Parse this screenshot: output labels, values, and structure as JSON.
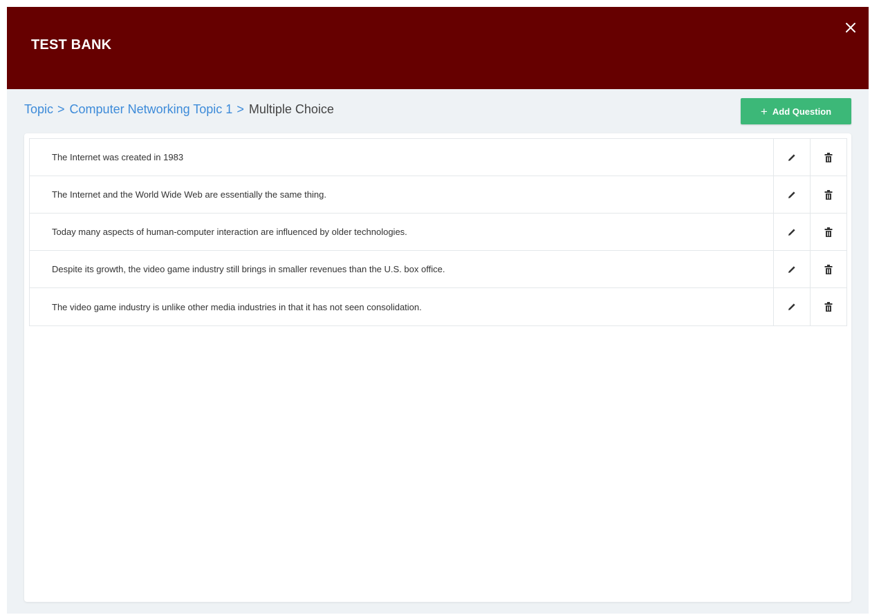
{
  "modal": {
    "title": "TEST BANK"
  },
  "breadcrumb": {
    "items": [
      "Topic",
      "Computer Networking Topic 1"
    ],
    "separator": ">",
    "current": "Multiple Choice"
  },
  "add_button": {
    "icon": "+",
    "label": "Add Question"
  },
  "questions": [
    {
      "text": "The Internet was created in 1983"
    },
    {
      "text": "The Internet and the World Wide Web are essentially the same thing."
    },
    {
      "text": "Today many aspects of human-computer interaction are influenced by older technologies."
    },
    {
      "text": "Despite its growth, the video game industry still brings in smaller revenues than the U.S. box office."
    },
    {
      "text": "The video game industry is unlike other media industries in that it has not seen consolidation."
    }
  ],
  "icons": {
    "close": "close-icon",
    "edit": "pencil-icon",
    "delete": "trash-icon"
  },
  "colors": {
    "header": "#660000",
    "accent_button": "#3cb878",
    "link": "#3d8bd9",
    "background": "#eef2f5"
  }
}
